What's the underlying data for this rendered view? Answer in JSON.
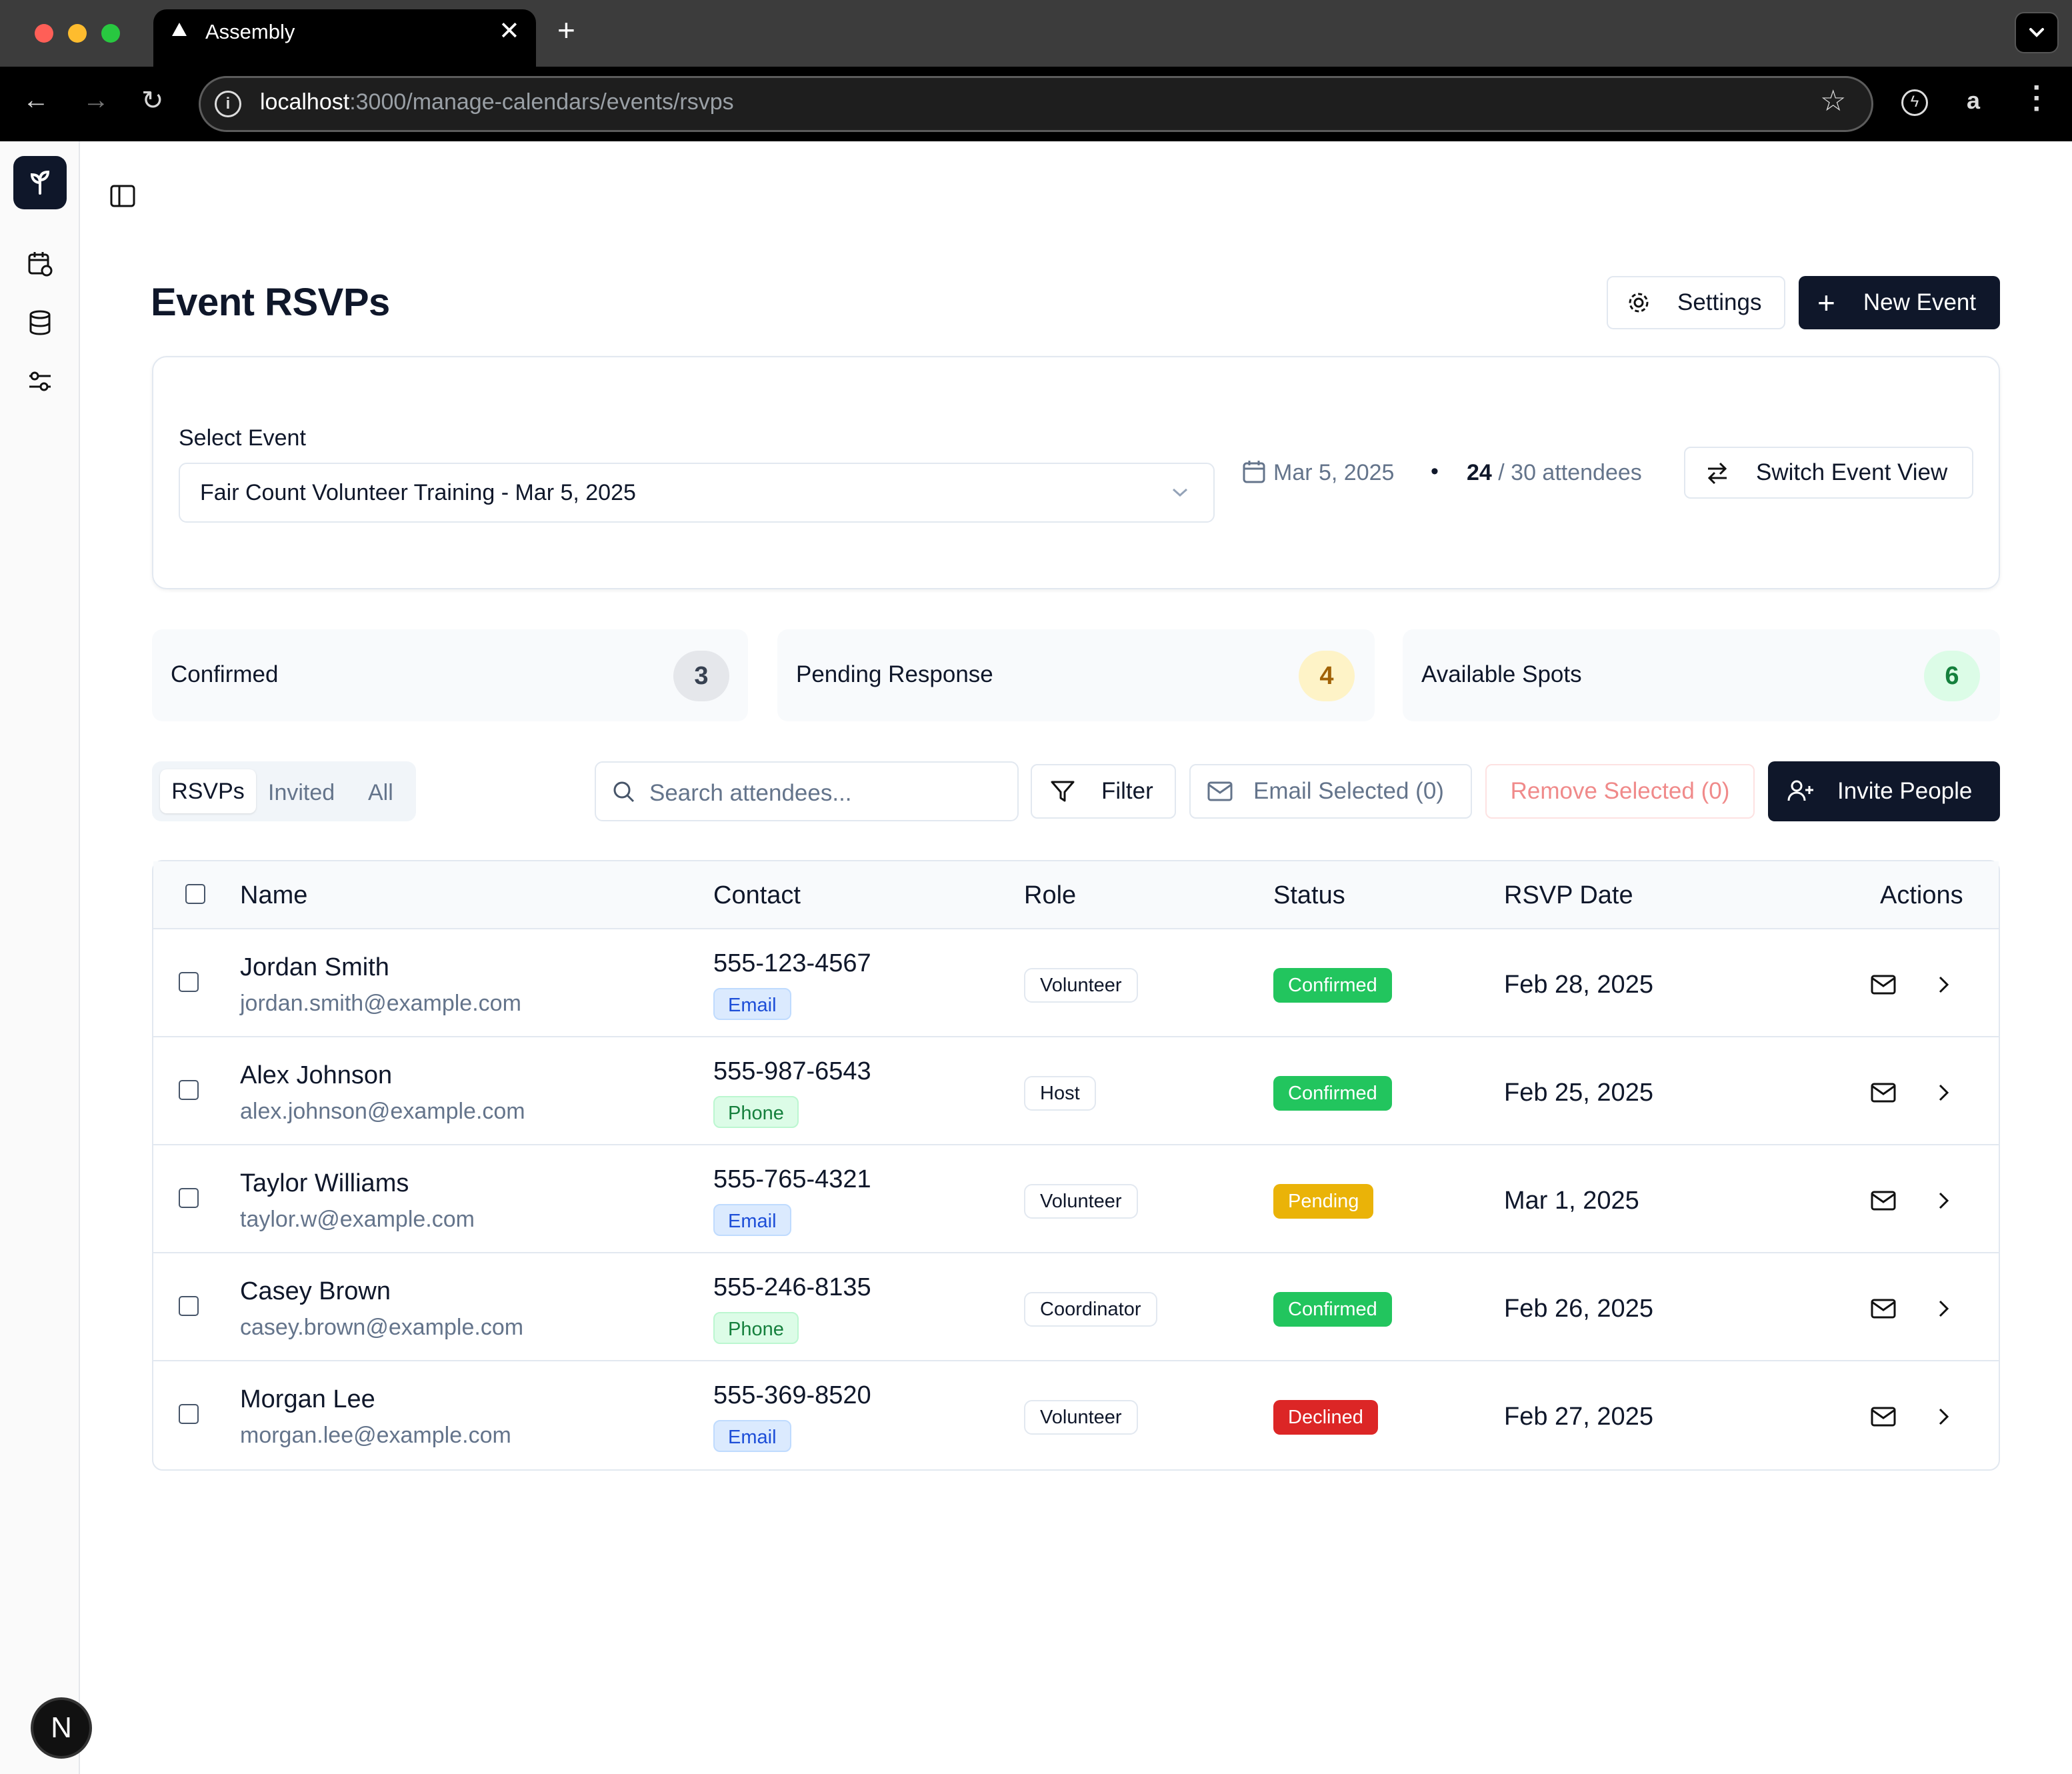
{
  "browser": {
    "tab_title": "Assembly",
    "url_host": "localhost",
    "url_path": ":3000/manage-calendars/events/rsvps"
  },
  "sidebar": {
    "avatar_letter": "N",
    "items": [
      "calendar-icon",
      "database-icon",
      "sliders-icon"
    ]
  },
  "header": {
    "title": "Event RSVPs",
    "settings_label": "Settings",
    "new_event_label": "New Event"
  },
  "event_select": {
    "label": "Select Event",
    "value": "Fair Count Volunteer Training - Mar 5, 2025",
    "date": "Mar 5, 2025",
    "bullet": "•",
    "attendees_count": "24",
    "attendees_rest": " / 30 attendees",
    "switch_label": "Switch Event View"
  },
  "stats": [
    {
      "label": "Confirmed",
      "value": "3"
    },
    {
      "label": "Pending Response",
      "value": "4"
    },
    {
      "label": "Available Spots",
      "value": "6"
    }
  ],
  "toolbar": {
    "tabs": [
      "RSVPs",
      "Invited",
      "All"
    ],
    "search_placeholder": "Search attendees...",
    "filter_label": "Filter",
    "email_selected_label": "Email Selected (0)",
    "remove_selected_label": "Remove Selected (0)",
    "invite_label": "Invite People"
  },
  "table": {
    "headers": [
      "Name",
      "Contact",
      "Role",
      "Status",
      "RSVP Date",
      "Actions"
    ],
    "rows": [
      {
        "name": "Jordan Smith",
        "email": "jordan.smith@example.com",
        "phone": "555-123-4567",
        "contact_pref": "Email",
        "role": "Volunteer",
        "status": "Confirmed",
        "rsvp_date": "Feb 28, 2025"
      },
      {
        "name": "Alex Johnson",
        "email": "alex.johnson@example.com",
        "phone": "555-987-6543",
        "contact_pref": "Phone",
        "role": "Host",
        "status": "Confirmed",
        "rsvp_date": "Feb 25, 2025"
      },
      {
        "name": "Taylor Williams",
        "email": "taylor.w@example.com",
        "phone": "555-765-4321",
        "contact_pref": "Email",
        "role": "Volunteer",
        "status": "Pending",
        "rsvp_date": "Mar 1, 2025"
      },
      {
        "name": "Casey Brown",
        "email": "casey.brown@example.com",
        "phone": "555-246-8135",
        "contact_pref": "Phone",
        "role": "Coordinator",
        "status": "Confirmed",
        "rsvp_date": "Feb 26, 2025"
      },
      {
        "name": "Morgan Lee",
        "email": "morgan.lee@example.com",
        "phone": "555-369-8520",
        "contact_pref": "Email",
        "role": "Volunteer",
        "status": "Declined",
        "rsvp_date": "Feb 27, 2025"
      }
    ]
  },
  "colors": {
    "primary": "#0f172a",
    "confirmed": "#22c55e",
    "pending": "#eab308",
    "declined": "#dc2626",
    "stat_confirmed_bg": "#e5e7eb",
    "stat_pending_bg": "#fef3c7",
    "stat_available_bg": "#dcfce7"
  }
}
